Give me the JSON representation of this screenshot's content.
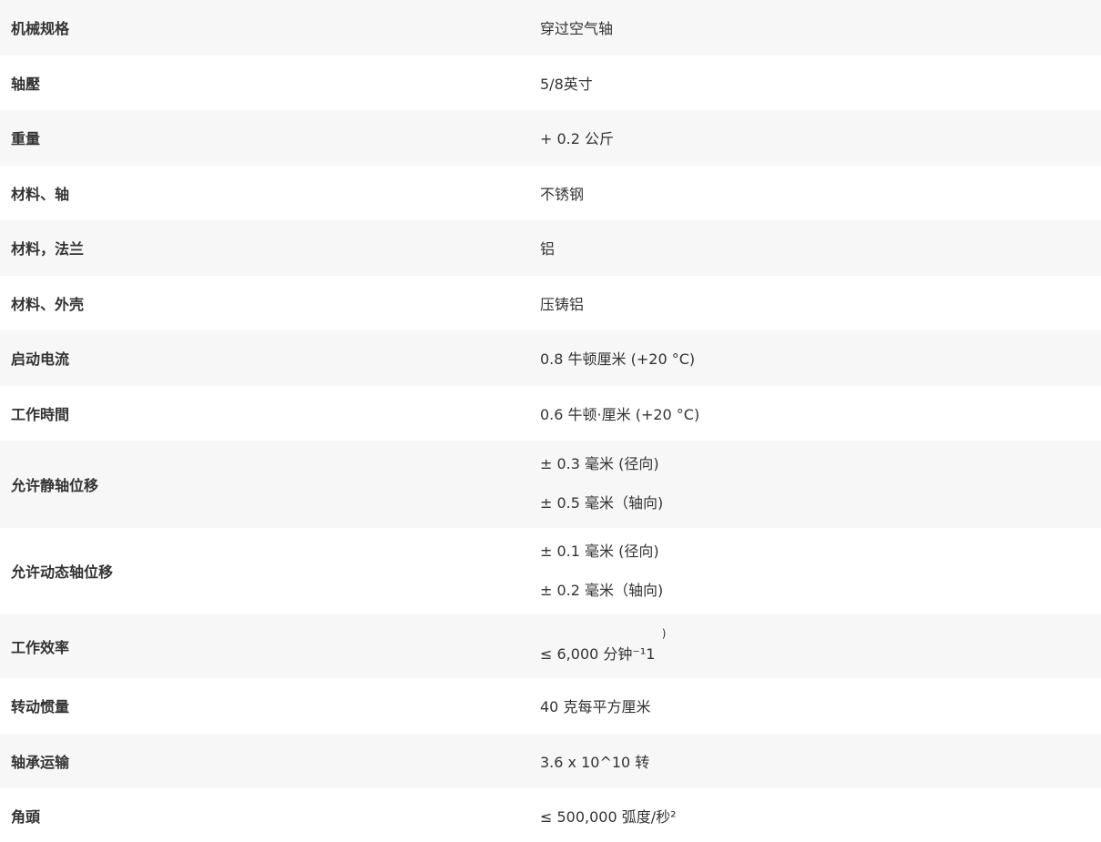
{
  "rows": [
    {
      "label": "机械规格",
      "value": "穿过空气轴"
    },
    {
      "label": "轴壓",
      "value": "5/8英寸"
    },
    {
      "label": "重量",
      "value": "+ 0.2 公斤"
    },
    {
      "label": "材料、轴",
      "value": "不锈钢"
    },
    {
      "label": "材料，法兰",
      "value": "铝"
    },
    {
      "label": "材料、外壳",
      "value": "压铸铝"
    },
    {
      "label": "启动电流",
      "value": "0.8 牛顿厘米 (+20 °C)"
    },
    {
      "label": "工作時間",
      "value": "0.6 牛顿·厘米 (+20 °C)"
    },
    {
      "label": "允许静轴位移",
      "value_line1": "± 0.3 毫米 (径向)",
      "value_line2": "± 0.5 毫米（轴向)"
    },
    {
      "label": "允许动态轴位移",
      "value_line1": "± 0.1 毫米 (径向)",
      "value_line2": "± 0.2 毫米（轴向)"
    },
    {
      "label": "工作效率",
      "value": "≤ 6,000 分钟⁻¹1",
      "value_sup": ")"
    },
    {
      "label": "转动惯量",
      "value": "40 克每平方厘米"
    },
    {
      "label": "轴承运输",
      "value": "3.6 x 10^10 转"
    },
    {
      "label": "角頭",
      "value": "≤ 500,000 弧度/秒²"
    }
  ]
}
